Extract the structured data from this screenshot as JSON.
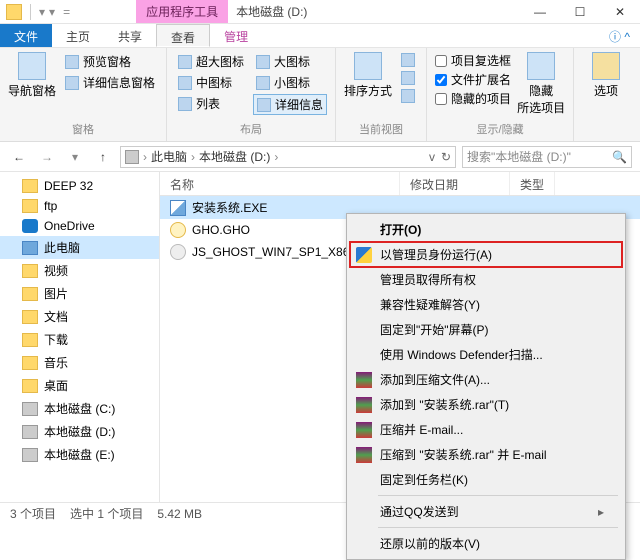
{
  "titlebar": {
    "tool_tab": "应用程序工具",
    "title": "本地磁盘 (D:)"
  },
  "win": {
    "min": "—",
    "max": "☐",
    "close": "✕"
  },
  "tabs": {
    "file": "文件",
    "home": "主页",
    "share": "共享",
    "view": "查看",
    "manage": "管理",
    "help": "?"
  },
  "ribbon": {
    "group1": {
      "nav_pane": "导航窗格",
      "preview_pane": "预览窗格",
      "detail_pane": "详细信息窗格",
      "label": "窗格"
    },
    "group2": {
      "xl_icon": "超大图标",
      "l_icon": "大图标",
      "m_icon": "中图标",
      "s_icon": "小图标",
      "list": "列表",
      "details": "详细信息",
      "label": "布局"
    },
    "group3": {
      "sort": "排序方式",
      "label": "当前视图"
    },
    "group4": {
      "chk_box": "项目复选框",
      "ext": "文件扩展名",
      "hidden_items": "隐藏的项目",
      "hide": "隐藏\n所选项目",
      "label": "显示/隐藏"
    },
    "group5": {
      "options": "选项"
    }
  },
  "addr": {
    "pc": "此电脑",
    "drive": "本地磁盘 (D:)",
    "search_placeholder": "搜索\"本地磁盘 (D:)\""
  },
  "sidebar": [
    {
      "label": "DEEP 32",
      "icon": "folder"
    },
    {
      "label": "ftp",
      "icon": "folder"
    },
    {
      "label": "OneDrive",
      "icon": "blue"
    },
    {
      "label": "此电脑",
      "icon": "pc",
      "selected": true
    },
    {
      "label": "视频",
      "icon": "folder"
    },
    {
      "label": "图片",
      "icon": "folder"
    },
    {
      "label": "文档",
      "icon": "folder"
    },
    {
      "label": "下载",
      "icon": "folder"
    },
    {
      "label": "音乐",
      "icon": "folder"
    },
    {
      "label": "桌面",
      "icon": "folder"
    },
    {
      "label": "本地磁盘 (C:)",
      "icon": "drive"
    },
    {
      "label": "本地磁盘 (D:)",
      "icon": "drive"
    },
    {
      "label": "本地磁盘 (E:)",
      "icon": "drive"
    }
  ],
  "columns": {
    "name": "名称",
    "date": "修改日期",
    "type": "类型"
  },
  "files": [
    {
      "name": "安装系统.EXE",
      "icon": "exe",
      "selected": true
    },
    {
      "name": "GHO.GHO",
      "icon": "gho"
    },
    {
      "name": "JS_GHOST_WIN7_SP1_X86_...",
      "icon": "iso"
    }
  ],
  "ctx": {
    "open": "打开(O)",
    "runas": "以管理员身份运行(A)",
    "troubleshoot": "管理员取得所有权",
    "compat": "兼容性疑难解答(Y)",
    "pin_start": "固定到\"开始\"屏幕(P)",
    "defender": "使用 Windows Defender扫描...",
    "add_rar": "添加到压缩文件(A)...",
    "add_named_rar": "添加到 \"安装系统.rar\"(T)",
    "compress_email": "压缩并 E-mail...",
    "compress_named_email": "压缩到 \"安装系统.rar\" 并 E-mail",
    "pin_taskbar": "固定到任务栏(K)",
    "qq_send": "通过QQ发送到",
    "restore": "还原以前的版本(V)"
  },
  "status": {
    "count": "3 个项目",
    "selected": "选中 1 个项目",
    "size": "5.42 MB"
  }
}
